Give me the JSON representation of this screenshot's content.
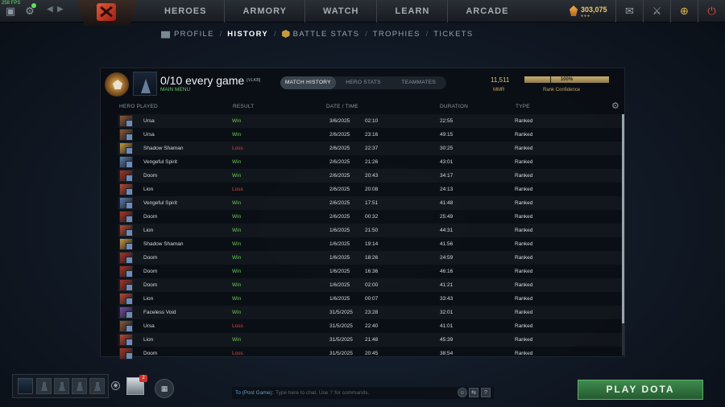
{
  "topbar": {
    "fps": "258 FPS",
    "nav": [
      "HEROES",
      "ARMORY",
      "WATCH",
      "LEARN",
      "ARCADE"
    ],
    "currency": "303,075"
  },
  "subnav": {
    "items": [
      "PROFILE",
      "HISTORY",
      "BATTLE STATS",
      "TROPHIES",
      "TICKETS"
    ],
    "active": "HISTORY"
  },
  "profile": {
    "name": "0/10 every game",
    "tag": "[VLKB]",
    "status": "MAIN MENU",
    "tabs": [
      "MATCH HISTORY",
      "HERO STATS",
      "TEAMMATES"
    ],
    "mmr_value": "11,511",
    "mmr_label": "MMR",
    "confidence_text": "100%",
    "confidence_pct": 100,
    "confidence_label": "Rank Confidence"
  },
  "table": {
    "headers": [
      "HERO PLAYED",
      "RESULT",
      "DATE / TIME",
      "DURATION",
      "TYPE"
    ],
    "rows": [
      {
        "hero": "Ursa",
        "result": "Win",
        "date": "3/6/2025",
        "time": "02:10",
        "duration": "22:55",
        "type": "Ranked"
      },
      {
        "hero": "Ursa",
        "result": "Win",
        "date": "2/6/2025",
        "time": "23:16",
        "duration": "49:15",
        "type": "Ranked"
      },
      {
        "hero": "Shadow Shaman",
        "result": "Loss",
        "date": "2/6/2025",
        "time": "22:37",
        "duration": "30:25",
        "type": "Ranked"
      },
      {
        "hero": "Vengeful Spirit",
        "result": "Win",
        "date": "2/6/2025",
        "time": "21:26",
        "duration": "43:01",
        "type": "Ranked"
      },
      {
        "hero": "Doom",
        "result": "Win",
        "date": "2/6/2025",
        "time": "20:43",
        "duration": "34:17",
        "type": "Ranked"
      },
      {
        "hero": "Lion",
        "result": "Loss",
        "date": "2/6/2025",
        "time": "20:08",
        "duration": "24:13",
        "type": "Ranked"
      },
      {
        "hero": "Vengeful Spirit",
        "result": "Win",
        "date": "2/6/2025",
        "time": "17:51",
        "duration": "41:48",
        "type": "Ranked"
      },
      {
        "hero": "Doom",
        "result": "Win",
        "date": "2/6/2025",
        "time": "00:32",
        "duration": "25:49",
        "type": "Ranked"
      },
      {
        "hero": "Lion",
        "result": "Win",
        "date": "1/6/2025",
        "time": "21:50",
        "duration": "44:31",
        "type": "Ranked"
      },
      {
        "hero": "Shadow Shaman",
        "result": "Win",
        "date": "1/6/2025",
        "time": "19:14",
        "duration": "41:56",
        "type": "Ranked"
      },
      {
        "hero": "Doom",
        "result": "Win",
        "date": "1/6/2025",
        "time": "18:26",
        "duration": "24:59",
        "type": "Ranked"
      },
      {
        "hero": "Doom",
        "result": "Win",
        "date": "1/6/2025",
        "time": "16:36",
        "duration": "46:16",
        "type": "Ranked"
      },
      {
        "hero": "Doom",
        "result": "Win",
        "date": "1/6/2025",
        "time": "02:00",
        "duration": "41:21",
        "type": "Ranked"
      },
      {
        "hero": "Lion",
        "result": "Win",
        "date": "1/6/2025",
        "time": "00:07",
        "duration": "33:43",
        "type": "Ranked"
      },
      {
        "hero": "Faceless Void",
        "result": "Win",
        "date": "31/5/2025",
        "time": "23:28",
        "duration": "32:01",
        "type": "Ranked"
      },
      {
        "hero": "Ursa",
        "result": "Loss",
        "date": "31/5/2025",
        "time": "22:40",
        "duration": "41:01",
        "type": "Ranked"
      },
      {
        "hero": "Lion",
        "result": "Win",
        "date": "31/5/2025",
        "time": "21:48",
        "duration": "45:39",
        "type": "Ranked"
      },
      {
        "hero": "Doom",
        "result": "Loss",
        "date": "31/5/2025",
        "time": "20:45",
        "duration": "38:54",
        "type": "Ranked"
      }
    ]
  },
  "hero_colors": {
    "Ursa": "#8a5a3a",
    "Shadow Shaman": "#c99a45",
    "Vengeful Spirit": "#5b7fb3",
    "Doom": "#a8352a",
    "Lion": "#b84a36",
    "Faceless Void": "#7a4ea8"
  },
  "bottom": {
    "friend_badge": "2",
    "chat_to": "To (Post Game):",
    "chat_placeholder": "Type here to chat. Use '/' for commands.",
    "help": "?",
    "play_label": "PLAY DOTA"
  },
  "colors": {
    "win": "#6bcb54",
    "loss": "#d9473c",
    "accent_gold": "#e4c07a",
    "play_green": "#3f8a4e"
  },
  "icons": {
    "menu": "dota-menu-icon",
    "settings": "gear-icon",
    "mail": "mail-icon",
    "armory": "armory-icon",
    "plus": "plus-icon",
    "power": "power-icon"
  }
}
